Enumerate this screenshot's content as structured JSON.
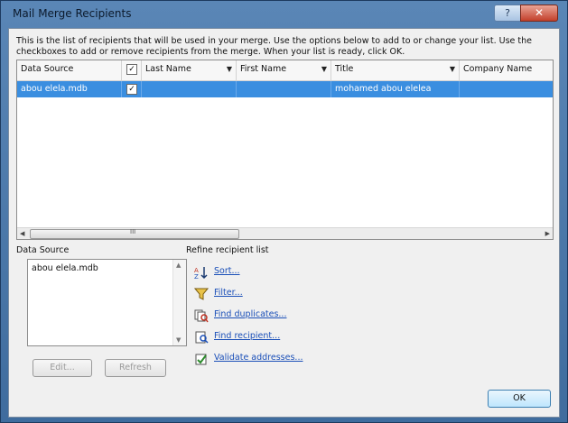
{
  "window": {
    "title": "Mail Merge Recipients",
    "help_label": "?",
    "close_label": "✕"
  },
  "description": "This is the list of recipients that will be used in your merge.  Use the options below to add to or change your list.  Use the checkboxes to add or remove recipients from the merge.  When your list is ready, click OK.",
  "grid": {
    "columns": [
      {
        "label": "Data Source",
        "has_dropdown": false
      },
      {
        "label": "✓",
        "type": "checkbox"
      },
      {
        "label": "Last Name",
        "has_dropdown": true
      },
      {
        "label": "First Name",
        "has_dropdown": true
      },
      {
        "label": "Title",
        "has_dropdown": true
      },
      {
        "label": "Company Name",
        "has_dropdown": false
      }
    ],
    "rows": [
      {
        "data_source": "abou elela.mdb",
        "checked": "✓",
        "last_name": "",
        "first_name": "",
        "title": "mohamed abou elelea",
        "company_name": "",
        "selected": true
      }
    ],
    "dropdown_arrow": "▼",
    "scroll_left": "◀",
    "scroll_right": "▶",
    "scroll_grip": "III"
  },
  "data_source_panel": {
    "label": "Data Source",
    "items": [
      "abou elela.mdb"
    ],
    "edit_button": "Edit...",
    "refresh_button": "Refresh",
    "scroll_up": "▲",
    "scroll_down": "▼"
  },
  "refine": {
    "label": "Refine recipient list",
    "links": [
      {
        "label": "Sort...",
        "icon": "sort-icon"
      },
      {
        "label": "Filter...",
        "icon": "filter-icon"
      },
      {
        "label": "Find duplicates...",
        "icon": "find-duplicates-icon"
      },
      {
        "label": "Find recipient...",
        "icon": "find-recipient-icon"
      },
      {
        "label": "Validate addresses...",
        "icon": "validate-addresses-icon"
      }
    ]
  },
  "ok_button": "OK",
  "colors": {
    "selection": "#3a8ee0",
    "link": "#1a4fb8",
    "frame": "#4a78aa"
  }
}
